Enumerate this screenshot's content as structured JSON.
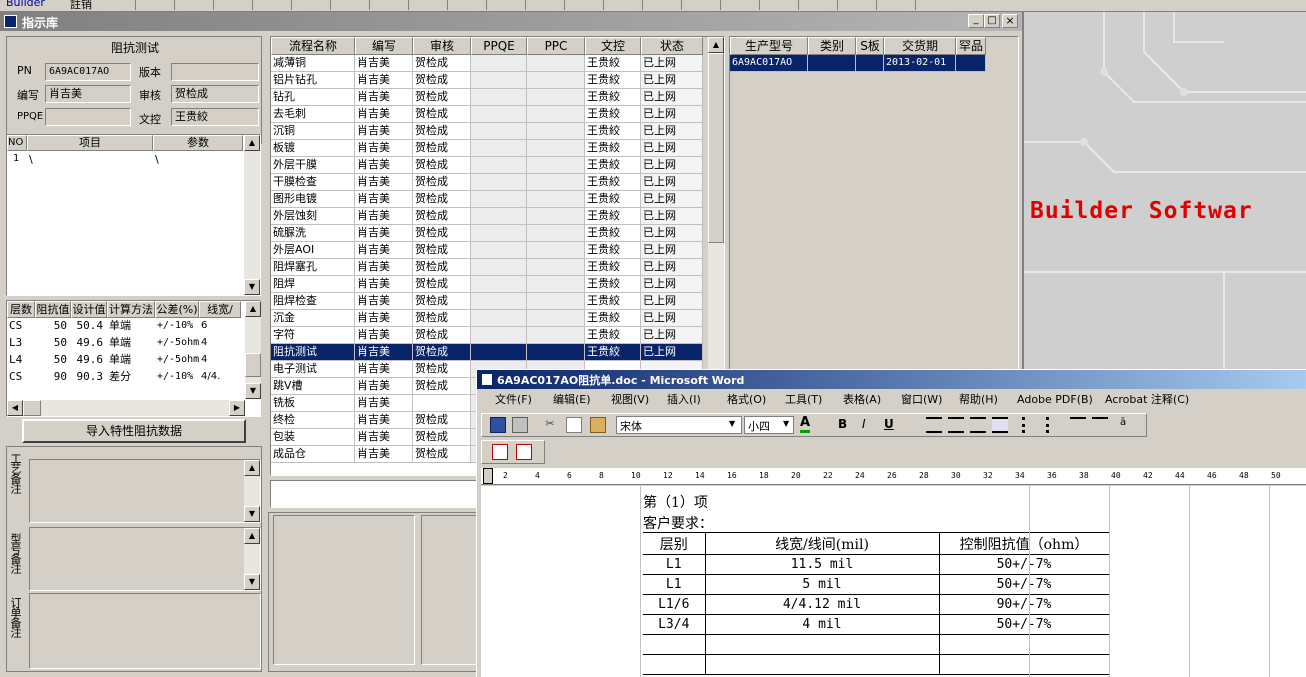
{
  "topbar": {
    "app_title": "Builder",
    "menu1": "註销",
    "toolbar_buttons": [
      "",
      "",
      "",
      "",
      "",
      "",
      "",
      "",
      "",
      "",
      "",
      "",
      "",
      "",
      "",
      "",
      "",
      "",
      "",
      "",
      ""
    ]
  },
  "mdi": {
    "title": "指示库",
    "controls": [
      "_",
      "□",
      "×"
    ]
  },
  "left": {
    "section_title": "阻抗测试",
    "pn_label": "PN",
    "pn_value": "6A9AC017AO",
    "version_label": "版本",
    "version_value": "",
    "author_label": "编写",
    "author_value": "肖吉美",
    "review_label": "审核",
    "review_value": "贺检成",
    "ppqe_label": "PPQE",
    "ppqe_value": "",
    "control_label": "文控",
    "control_value": "王贵絞",
    "param_table": {
      "headers": [
        "NO",
        "项目",
        "参数"
      ],
      "rows": [
        [
          "1",
          "\\",
          "\\"
        ]
      ]
    },
    "imp_table": {
      "headers": [
        "层数",
        "阻抗值",
        "设计值",
        "计算方法",
        "公差(%)",
        "线宽/"
      ],
      "rows": [
        [
          "CS",
          "50",
          "50.4",
          "单端",
          "+/-10%",
          "6"
        ],
        [
          "L3",
          "50",
          "49.6",
          "单端",
          "+/-5ohm",
          "4"
        ],
        [
          "L4",
          "50",
          "49.6",
          "单端",
          "+/-5ohm",
          "4"
        ],
        [
          "CS",
          "90",
          "90.3",
          "差分",
          "+/-10%",
          "4/4."
        ]
      ]
    },
    "import_button": "导入特性阻抗数据",
    "note1_label": "工艺备注",
    "note2_label": "型号备注",
    "note3_label": "订单备注"
  },
  "process": {
    "headers": [
      "流程名称",
      "编写",
      "审核",
      "PPQE",
      "PPC",
      "文控",
      "状态"
    ],
    "rows": [
      [
        "减薄铜",
        "肖吉美",
        "贺检成",
        "",
        "",
        "王贵絞",
        "已上网"
      ],
      [
        "铝片钻孔",
        "肖吉美",
        "贺检成",
        "",
        "",
        "王贵絞",
        "已上网"
      ],
      [
        "钻孔",
        "肖吉美",
        "贺检成",
        "",
        "",
        "王贵絞",
        "已上网"
      ],
      [
        "去毛刺",
        "肖吉美",
        "贺检成",
        "",
        "",
        "王贵絞",
        "已上网"
      ],
      [
        "沉铜",
        "肖吉美",
        "贺检成",
        "",
        "",
        "王贵絞",
        "已上网"
      ],
      [
        "板镀",
        "肖吉美",
        "贺检成",
        "",
        "",
        "王贵絞",
        "已上网"
      ],
      [
        "外层干膜",
        "肖吉美",
        "贺检成",
        "",
        "",
        "王贵絞",
        "已上网"
      ],
      [
        "干膜检查",
        "肖吉美",
        "贺检成",
        "",
        "",
        "王贵絞",
        "已上网"
      ],
      [
        "图形电镀",
        "肖吉美",
        "贺检成",
        "",
        "",
        "王贵絞",
        "已上网"
      ],
      [
        "外层蚀刻",
        "肖吉美",
        "贺检成",
        "",
        "",
        "王贵絞",
        "已上网"
      ],
      [
        "硫脲洗",
        "肖吉美",
        "贺检成",
        "",
        "",
        "王贵絞",
        "已上网"
      ],
      [
        "外层AOI",
        "肖吉美",
        "贺检成",
        "",
        "",
        "王贵絞",
        "已上网"
      ],
      [
        "阻焊塞孔",
        "肖吉美",
        "贺检成",
        "",
        "",
        "王贵絞",
        "已上网"
      ],
      [
        "阻焊",
        "肖吉美",
        "贺检成",
        "",
        "",
        "王贵絞",
        "已上网"
      ],
      [
        "阻焊检查",
        "肖吉美",
        "贺检成",
        "",
        "",
        "王贵絞",
        "已上网"
      ],
      [
        "沉金",
        "肖吉美",
        "贺检成",
        "",
        "",
        "王贵絞",
        "已上网"
      ],
      [
        "字符",
        "肖吉美",
        "贺检成",
        "",
        "",
        "王贵絞",
        "已上网"
      ],
      [
        "阻抗测试",
        "肖吉美",
        "贺检成",
        "",
        "",
        "王贵絞",
        "已上网"
      ],
      [
        "电子测试",
        "肖吉美",
        "贺检成",
        "",
        "",
        "",
        ""
      ],
      [
        "跳V槽",
        "肖吉美",
        "贺检成",
        "",
        "",
        "",
        ""
      ],
      [
        "铣板",
        "肖吉美",
        "",
        "",
        "",
        "",
        ""
      ],
      [
        "终检",
        "肖吉美",
        "贺检成",
        "",
        "",
        "",
        ""
      ],
      [
        "包装",
        "肖吉美",
        "贺检成",
        "",
        "",
        "",
        ""
      ],
      [
        "成品仓",
        "肖吉美",
        "贺检成",
        "",
        "",
        "",
        ""
      ]
    ],
    "selected_index": 17
  },
  "orders": {
    "headers": [
      "生产型号",
      "类别",
      "S板",
      "交货期",
      "罕品"
    ],
    "rows": [
      [
        "6A9AC017AO",
        "",
        "",
        "2013-02-01",
        ""
      ]
    ]
  },
  "background": {
    "brand": "Builder Softwar"
  },
  "word": {
    "title": "6A9AC017AO阻抗单.doc - Microsoft Word",
    "menus": [
      "文件(F)",
      "编辑(E)",
      "视图(V)",
      "插入(I)",
      "格式(O)",
      "工具(T)",
      "表格(A)",
      "窗口(W)",
      "帮助(H)",
      "Adobe PDF(B)",
      "Acrobat 注释(C)"
    ],
    "font_name": "宋体",
    "font_size": "小四",
    "ruler_ticks": [
      "2",
      "4",
      "6",
      "8",
      "10",
      "12",
      "14",
      "16",
      "18",
      "20",
      "22",
      "24",
      "26",
      "28",
      "30",
      "32",
      "34",
      "36",
      "38",
      "40",
      "42",
      "44",
      "46",
      "48",
      "50"
    ],
    "doc": {
      "line1": "第（1）项",
      "line2": "客户要求：",
      "table_headers": [
        "层别",
        "线宽/线间(mil)",
        "控制阻抗值（ohm）"
      ],
      "table_rows": [
        [
          "L1",
          "11.5 mil",
          "50+/-7%"
        ],
        [
          "L1",
          "5 mil",
          "50+/-7%"
        ],
        [
          "L1/6",
          "4/4.12 mil",
          "90+/-7%"
        ],
        [
          "L3/4",
          "4 mil",
          "50+/-7%"
        ],
        [
          "",
          "",
          ""
        ],
        [
          "",
          "",
          ""
        ]
      ]
    }
  }
}
